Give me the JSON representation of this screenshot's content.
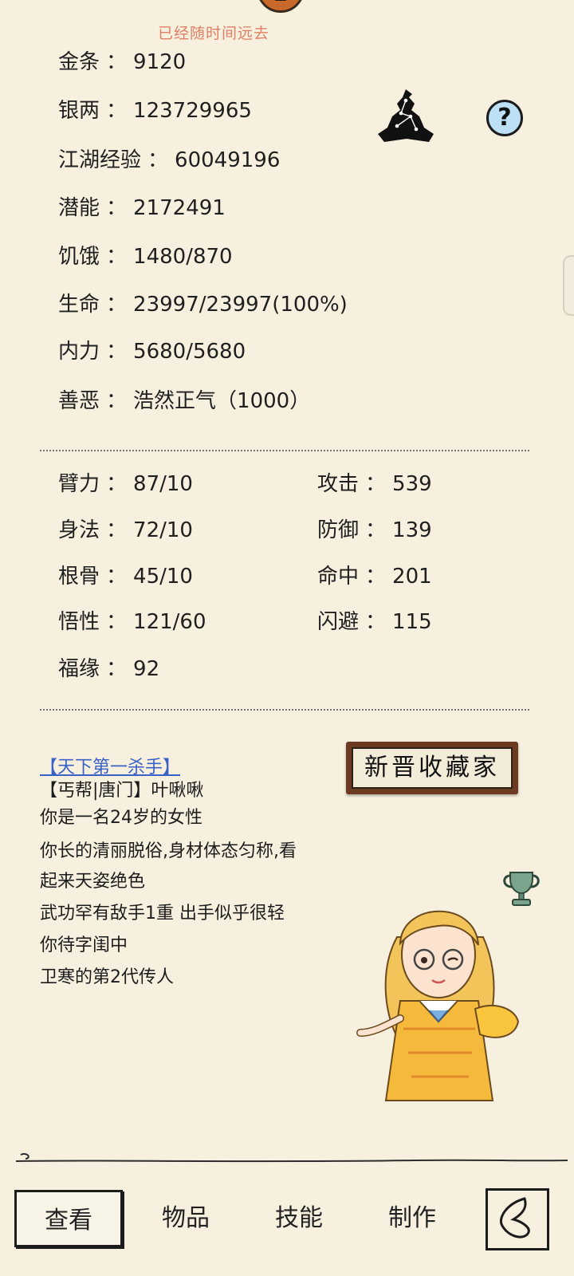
{
  "banner_text": "已经随时间远去",
  "stats": [
    {
      "label": "金条",
      "value": "9120"
    },
    {
      "label": "银两",
      "value": "123729965"
    },
    {
      "label": "江湖经验",
      "value": "60049196"
    },
    {
      "label": "潜能",
      "value": "2172491"
    },
    {
      "label": "饥饿",
      "value": "1480/870"
    },
    {
      "label": "生命",
      "value": "23997/23997(100%)"
    },
    {
      "label": "内力",
      "value": "5680/5680"
    },
    {
      "label": "善恶",
      "value": "浩然正气（1000）"
    }
  ],
  "separator": "：",
  "attributes_left": [
    {
      "label": "臂力",
      "value": "87/10"
    },
    {
      "label": "身法",
      "value": "72/10"
    },
    {
      "label": "根骨",
      "value": "45/10"
    },
    {
      "label": "悟性",
      "value": "121/60"
    },
    {
      "label": "福缘",
      "value": "92"
    }
  ],
  "attributes_right": [
    {
      "label": "攻击",
      "value": "539"
    },
    {
      "label": "防御",
      "value": "139"
    },
    {
      "label": "命中",
      "value": "201"
    },
    {
      "label": "闪避",
      "value": "115"
    }
  ],
  "help_label": "?",
  "profile": {
    "title": "【天下第一杀手】",
    "lines": [
      "【丐帮|唐门】叶啾啾",
      "你是一名24岁的女性",
      "你长的清丽脱俗,身材体态匀称,看",
      "起来天姿绝色",
      "武功罕有敌手1重 出手似乎很轻",
      "你待字闺中",
      "卫寒的第2代传人"
    ]
  },
  "plaque_text": "新晋收藏家",
  "icons": {
    "meditation": "meditating-sage-icon",
    "help": "question-mark-icon",
    "trophy": "trophy-icon",
    "back": "back-icon"
  },
  "colors": {
    "background": "#f7f0df",
    "banner": "#e08065",
    "title_link": "#3a61c6"
  },
  "nav": {
    "tabs": [
      "查看",
      "物品",
      "技能",
      "制作"
    ],
    "active_index": 0
  }
}
